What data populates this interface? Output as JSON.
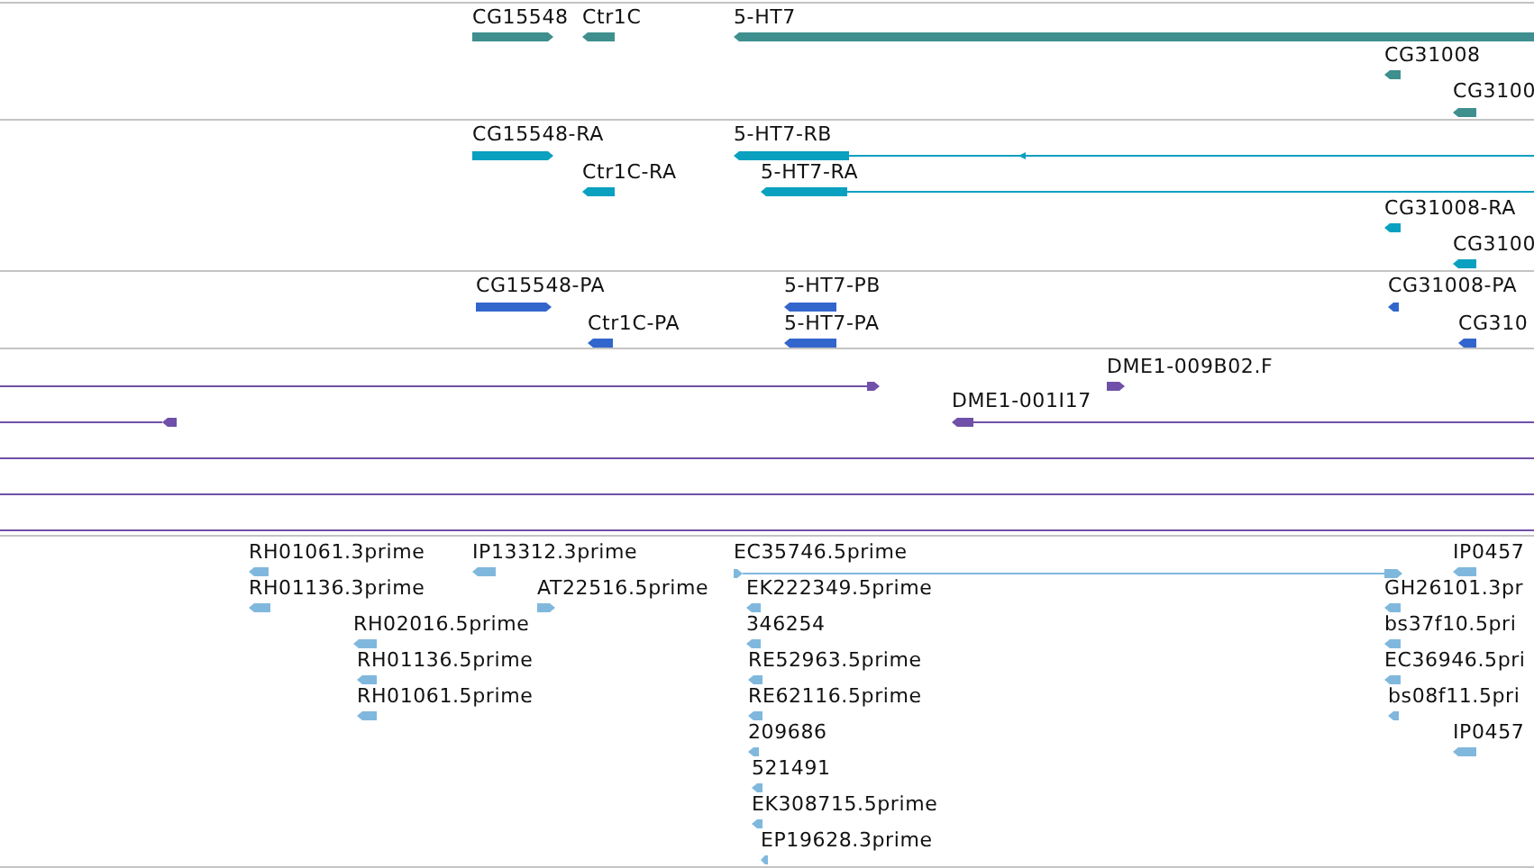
{
  "tracks": [
    {
      "kind": "gene",
      "features": [
        {
          "label": "CG15548",
          "reverse": false
        },
        {
          "label": "Ctr1C",
          "reverse": true
        },
        {
          "label": "5-HT7",
          "reverse": true
        },
        {
          "label": "CG31008",
          "reverse": true
        },
        {
          "label": "CG3100",
          "reverse": true
        }
      ]
    },
    {
      "kind": "transcript",
      "features": [
        {
          "label": "CG15548-RA",
          "reverse": false
        },
        {
          "label": "5-HT7-RB",
          "reverse": true
        },
        {
          "label": "Ctr1C-RA",
          "reverse": true
        },
        {
          "label": "5-HT7-RA",
          "reverse": true
        },
        {
          "label": "CG31008-RA",
          "reverse": true
        },
        {
          "label": "CG3100",
          "reverse": true
        }
      ]
    },
    {
      "kind": "protein",
      "features": [
        {
          "label": "CG15548-PA",
          "reverse": false
        },
        {
          "label": "5-HT7-PB",
          "reverse": true
        },
        {
          "label": "CG31008-PA",
          "reverse": true
        },
        {
          "label": "Ctr1C-PA",
          "reverse": true
        },
        {
          "label": "5-HT7-PA",
          "reverse": true
        },
        {
          "label": "CG310",
          "reverse": true
        }
      ]
    },
    {
      "kind": "alignment",
      "features": [
        {
          "kind": "arrow",
          "reverse": false
        },
        {
          "kind": "arrow",
          "label": "DME1-009B02.F",
          "reverse": false
        },
        {
          "kind": "arrow",
          "reverse": true
        },
        {
          "kind": "arrow",
          "label": "DME1-001I17",
          "reverse": true
        },
        {
          "kind": "plain"
        },
        {
          "kind": "plain"
        },
        {
          "kind": "plain"
        }
      ]
    },
    {
      "kind": "est",
      "features": [
        {
          "label": "RH01061.3prime",
          "reverse": true
        },
        {
          "label": "IP13312.3prime",
          "reverse": true
        },
        {
          "label": "EC35746.5prime",
          "reverse": false
        },
        {
          "label": "IP0457",
          "reverse": true
        },
        {
          "label": "RH01136.3prime",
          "reverse": true
        },
        {
          "label": "AT22516.5prime",
          "reverse": false
        },
        {
          "label": "EK222349.5prime",
          "reverse": true
        },
        {
          "label": "GH26101.3pr",
          "reverse": true
        },
        {
          "label": "RH02016.5prime",
          "reverse": true
        },
        {
          "label": "346254",
          "reverse": true
        },
        {
          "label": "bs37f10.5pri",
          "reverse": true
        },
        {
          "label": "RH01136.5prime",
          "reverse": true
        },
        {
          "label": "RE52963.5prime",
          "reverse": true
        },
        {
          "label": "EC36946.5pri",
          "reverse": true
        },
        {
          "label": "RH01061.5prime",
          "reverse": true
        },
        {
          "label": "RE62116.5prime",
          "reverse": true
        },
        {
          "label": "bs08f11.5pri",
          "reverse": true
        },
        {
          "label": "209686",
          "reverse": true
        },
        {
          "label": "IP0457",
          "reverse": true
        },
        {
          "label": "521491",
          "reverse": true
        },
        {
          "label": "EK308715.5prime",
          "reverse": true
        },
        {
          "label": "EP19628.3prime",
          "reverse": true
        }
      ]
    }
  ]
}
